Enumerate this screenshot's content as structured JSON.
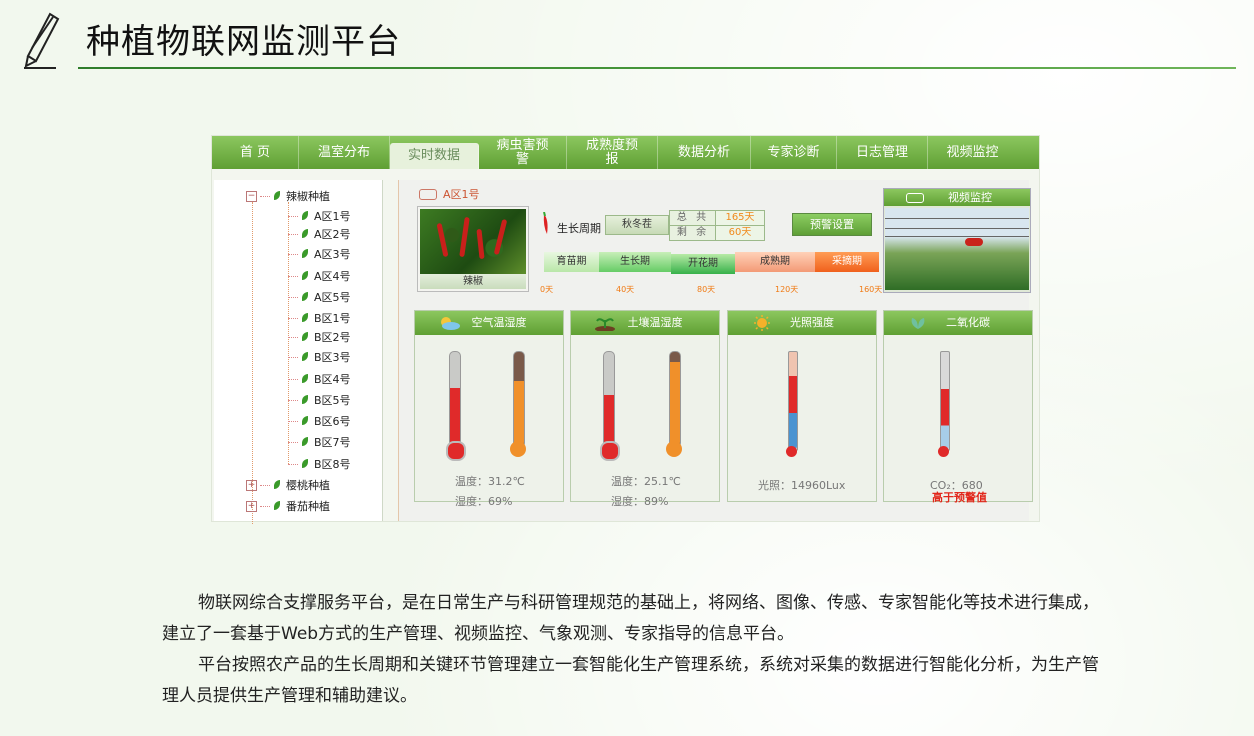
{
  "page": {
    "title": "种植物联网监测平台",
    "paragraphs": [
      "物联网综合支撑服务平台，是在日常生产与科研管理规范的基础上，将网络、图像、传感、专家智能化等技术进行集成，建立了一套基于Web方式的生产管理、视频监控、气象观测、专家指导的信息平台。",
      "平台按照农产品的生长周期和关键环节管理建立一套智能化生产管理系统，系统对采集的数据进行智能化分析，为生产管理人员提供生产管理和辅助建议。"
    ]
  },
  "nav": {
    "items": [
      "首 页",
      "温室分布",
      "实时数据",
      "病虫害预警",
      "成熟度预报",
      "数据分析",
      "专家诊断",
      "日志管理",
      "视频监控"
    ],
    "active": "实时数据"
  },
  "tree": {
    "root": "辣椒种植",
    "zones": [
      "A区1号",
      "A区2号",
      "A区3号",
      "A区4号",
      "A区5号",
      "B区1号",
      "B区2号",
      "B区3号",
      "B区4号",
      "B区5号",
      "B区6号",
      "B区7号",
      "B区8号"
    ],
    "others": [
      "樱桃种植",
      "番茄种植"
    ]
  },
  "zone": {
    "name": "A区1号",
    "crop_caption": "辣椒",
    "growth_label": "生长周期",
    "season": "秋冬茬",
    "total_label": "总 共",
    "total_value": "165天",
    "remain_label": "剩 余",
    "remain_value": "60天",
    "alert_button": "预警设置",
    "stages": [
      "育苗期",
      "生长期",
      "开花期",
      "成熟期",
      "采摘期"
    ],
    "axis_ticks": [
      "0天",
      "40天",
      "80天",
      "120天",
      "160天"
    ]
  },
  "video": {
    "title": "视频监控"
  },
  "sensors": [
    {
      "title": "空气温湿度",
      "line1": "温度：31.2℃",
      "line2": "湿度：69%",
      "temp_level": 0.62,
      "hum_level": 0.69
    },
    {
      "title": "土壤温湿度",
      "line1": "温度：25.1℃",
      "line2": "湿度：89%",
      "temp_level": 0.55,
      "hum_level": 0.89
    },
    {
      "title": "光照强度",
      "line1": "光照：14960Lux",
      "level": 0.75
    },
    {
      "title": "二氧化碳",
      "line1": "CO₂：680",
      "line2": "高于预警值",
      "level": 0.42
    }
  ],
  "colors": {
    "accent": "#5f9f33",
    "warn": "#e2281c",
    "orange": "#f08a1c"
  }
}
